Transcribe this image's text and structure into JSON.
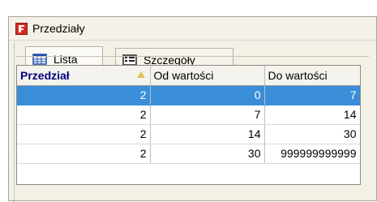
{
  "window": {
    "title": "Przedziały",
    "icon": "app-logo-icon"
  },
  "tabs": [
    {
      "label": "Lista",
      "icon": "table-icon",
      "active": true
    },
    {
      "label": "Szczegóły",
      "icon": "details-form-icon",
      "active": false
    }
  ],
  "table": {
    "columns": [
      "Przedział",
      "Od wartości",
      "Do wartości"
    ],
    "sorted_column": "Przedział",
    "rows": [
      {
        "przedzial": "2",
        "od": "0",
        "do": "7",
        "selected": true
      },
      {
        "przedzial": "2",
        "od": "7",
        "do": "14",
        "selected": false
      },
      {
        "przedzial": "2",
        "od": "14",
        "do": "30",
        "selected": false
      },
      {
        "przedzial": "2",
        "od": "30",
        "do": "999999999999",
        "selected": false
      }
    ]
  },
  "colors": {
    "selection": "#3a8ed8",
    "window_bg": "#f3f0e6",
    "header_sorted_text": "#000080"
  }
}
